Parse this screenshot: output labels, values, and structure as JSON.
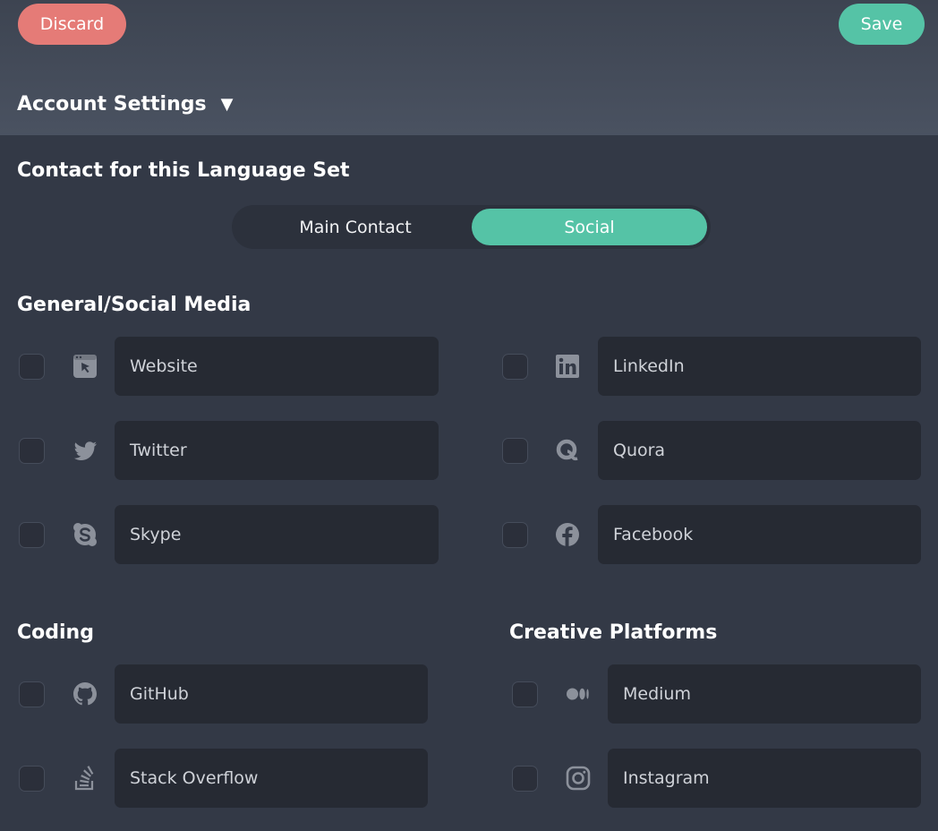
{
  "header": {
    "discard_label": "Discard",
    "save_label": "Save",
    "account_settings_label": "Account Settings",
    "account_settings_caret": "▼"
  },
  "contact": {
    "title": "Contact for this Language Set",
    "tabs": [
      {
        "label": "Main Contact",
        "active": false
      },
      {
        "label": "Social",
        "active": true
      }
    ]
  },
  "general": {
    "title": "General/Social Media",
    "items": [
      {
        "label": "Website",
        "icon": "browser-cursor-icon"
      },
      {
        "label": "LinkedIn",
        "icon": "linkedin-icon"
      },
      {
        "label": "Twitter",
        "icon": "twitter-icon"
      },
      {
        "label": "Quora",
        "icon": "quora-icon"
      },
      {
        "label": "Skype",
        "icon": "skype-icon"
      },
      {
        "label": "Facebook",
        "icon": "facebook-icon"
      }
    ]
  },
  "coding": {
    "title": "Coding",
    "items": [
      {
        "label": "GitHub",
        "icon": "github-icon"
      },
      {
        "label": "Stack Overflow",
        "icon": "stackoverflow-icon"
      }
    ]
  },
  "creative": {
    "title": "Creative Platforms",
    "items": [
      {
        "label": "Medium",
        "icon": "medium-icon"
      },
      {
        "label": "Instagram",
        "icon": "instagram-icon"
      }
    ]
  },
  "colors": {
    "accent": "#55c3a6",
    "danger": "#e57b77",
    "background": "#333946",
    "field": "#262a33",
    "icon": "#8c919b"
  }
}
